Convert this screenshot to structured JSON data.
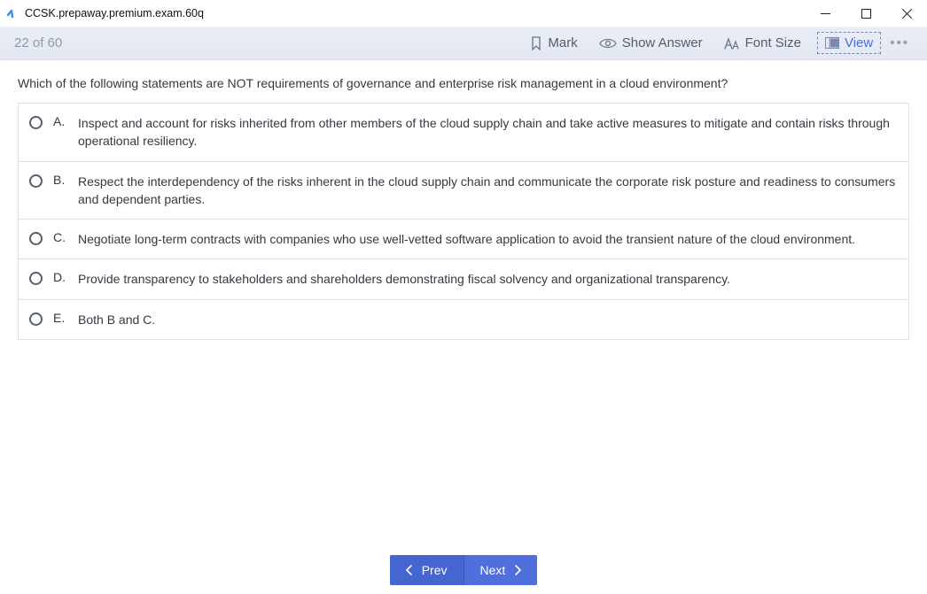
{
  "window": {
    "title": "CCSK.prepaway.premium.exam.60q"
  },
  "toolbar": {
    "counter": "22 of 60",
    "mark_label": "Mark",
    "show_answer_label": "Show Answer",
    "font_size_label": "Font Size",
    "view_label": "View"
  },
  "question": {
    "text": "Which of the following statements are NOT requirements of governance and enterprise risk management in a cloud environment?",
    "options": [
      {
        "letter": "A.",
        "text": "Inspect and account for risks inherited from other members of the cloud supply chain and take active measures to mitigate and contain risks through operational resiliency."
      },
      {
        "letter": "B.",
        "text": "Respect the interdependency of the risks inherent in the cloud supply chain and communicate the corporate risk posture and readiness to consumers and dependent parties."
      },
      {
        "letter": "C.",
        "text": "Negotiate long-term contracts with companies who use well-vetted software application to avoid the transient nature of the cloud environment."
      },
      {
        "letter": "D.",
        "text": "Provide transparency to stakeholders and shareholders demonstrating fiscal solvency and organizational transparency."
      },
      {
        "letter": "E.",
        "text": "Both B and C."
      }
    ]
  },
  "nav": {
    "prev_label": "Prev",
    "next_label": "Next"
  }
}
